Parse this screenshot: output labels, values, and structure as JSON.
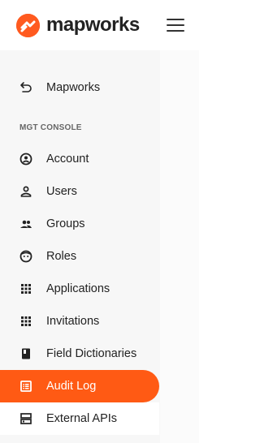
{
  "app": {
    "brand": "mapworks",
    "accent_color": "#ff5a1f"
  },
  "header": {
    "menu_icon": "hamburger-icon"
  },
  "sidebar": {
    "back_item": {
      "label": "Mapworks",
      "icon": "back-arrow-icon"
    },
    "section_title": "MGT CONSOLE",
    "items": [
      {
        "label": "Account",
        "icon": "account-circle-icon"
      },
      {
        "label": "Users",
        "icon": "person-icon"
      },
      {
        "label": "Groups",
        "icon": "group-icon"
      },
      {
        "label": "Roles",
        "icon": "face-icon"
      },
      {
        "label": "Applications",
        "icon": "apps-grid-icon"
      },
      {
        "label": "Invitations",
        "icon": "apps-grid-icon"
      },
      {
        "label": "Field Dictionaries",
        "icon": "book-icon"
      },
      {
        "label": "Audit Log",
        "icon": "list-alt-icon",
        "active": true
      },
      {
        "label": "External APIs",
        "icon": "dns-icon"
      }
    ]
  }
}
